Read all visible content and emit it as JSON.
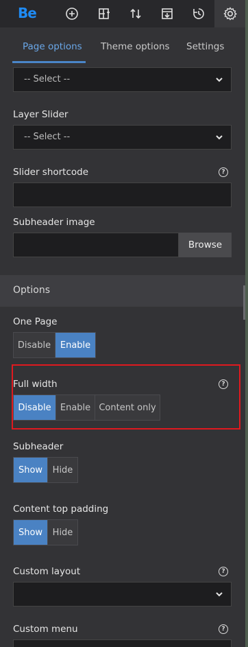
{
  "toolbar": {
    "logo": "Be",
    "icons": [
      "add-icon",
      "layout-add-icon",
      "sort-icon",
      "export-icon",
      "history-icon",
      "settings-icon"
    ]
  },
  "tabs": [
    {
      "label": "Page options",
      "active": true
    },
    {
      "label": "Theme options",
      "active": false
    },
    {
      "label": "Settings",
      "active": false
    }
  ],
  "fields": {
    "first_select": {
      "value": "-- Select --"
    },
    "layer_slider": {
      "label": "Layer Slider",
      "value": "-- Select --"
    },
    "slider_shortcode": {
      "label": "Slider shortcode",
      "value": ""
    },
    "subheader_image": {
      "label": "Subheader image",
      "value": "",
      "button": "Browse"
    }
  },
  "options": {
    "title": "Options",
    "one_page": {
      "label": "One Page",
      "buttons": [
        "Disable",
        "Enable"
      ],
      "selected": "Enable"
    },
    "full_width": {
      "label": "Full width",
      "buttons": [
        "Disable",
        "Enable",
        "Content only"
      ],
      "selected": "Disable"
    },
    "subheader": {
      "label": "Subheader",
      "buttons": [
        "Show",
        "Hide"
      ],
      "selected": "Show"
    },
    "content_top_padding": {
      "label": "Content top padding",
      "buttons": [
        "Show",
        "Hide"
      ],
      "selected": "Show"
    },
    "custom_layout": {
      "label": "Custom layout",
      "value": ""
    },
    "custom_menu": {
      "label": "Custom menu"
    }
  },
  "help_glyph": "?",
  "colors": {
    "accent": "#4a82c3",
    "highlight": "#e0191f",
    "logo": "#1f8bf4"
  }
}
